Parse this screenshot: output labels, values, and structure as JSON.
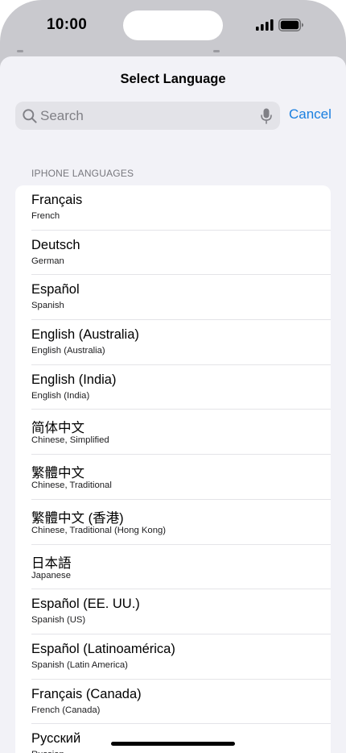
{
  "status_bar": {
    "time": "10:00"
  },
  "sheet": {
    "title": "Select Language",
    "search": {
      "placeholder": "Search",
      "value": ""
    },
    "cancel_label": "Cancel",
    "section_header": "IPHONE LANGUAGES",
    "languages": [
      {
        "native": "Français",
        "english": "French"
      },
      {
        "native": "Deutsch",
        "english": "German"
      },
      {
        "native": "Español",
        "english": "Spanish"
      },
      {
        "native": "English (Australia)",
        "english": "English (Australia)"
      },
      {
        "native": "English (India)",
        "english": "English (India)"
      },
      {
        "native": "简体中文",
        "english": "Chinese, Simplified"
      },
      {
        "native": "繁體中文",
        "english": "Chinese, Traditional"
      },
      {
        "native": "繁體中文 (香港)",
        "english": "Chinese, Traditional (Hong Kong)"
      },
      {
        "native": "日本語",
        "english": "Japanese"
      },
      {
        "native": "Español (EE. UU.)",
        "english": "Spanish (US)"
      },
      {
        "native": "Español (Latinoamérica)",
        "english": "Spanish (Latin America)"
      },
      {
        "native": "Français (Canada)",
        "english": "French (Canada)"
      },
      {
        "native": "Русский",
        "english": "Russian"
      }
    ]
  },
  "colors": {
    "accent": "#1a7fe0",
    "sheet_background": "#f2f2f7",
    "backdrop": "#c9c9ce"
  },
  "icons": {
    "search": "search-icon",
    "microphone": "microphone-icon",
    "signal": "cellular-signal-icon",
    "battery": "battery-icon"
  }
}
